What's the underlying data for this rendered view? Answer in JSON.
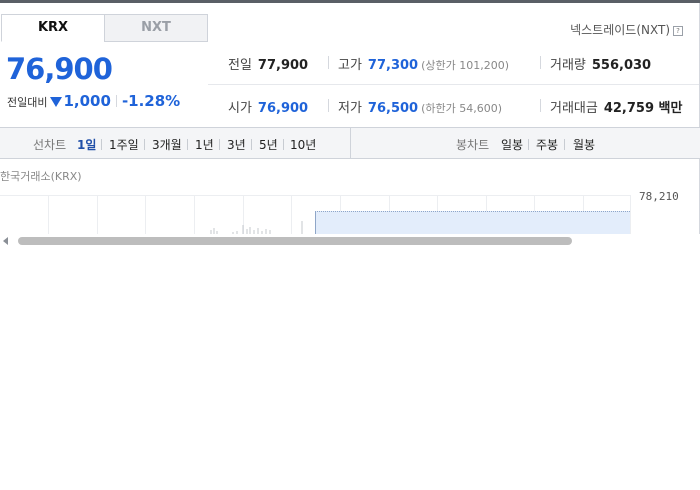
{
  "tabs": [
    {
      "label": "KRX",
      "active": true
    },
    {
      "label": "NXT",
      "active": false
    }
  ],
  "nxt_link": {
    "label": "넥스트레이드(NXT)",
    "icon": "help-icon",
    "icon_glyph": "?"
  },
  "price": {
    "current": "76,900",
    "change_label": "전일대비",
    "change_direction": "down",
    "change_value": "1,000",
    "change_percent": "-1.28%"
  },
  "stats": {
    "prev_close": {
      "label": "전일",
      "value": "77,900"
    },
    "high": {
      "label": "고가",
      "value": "77,300",
      "sub": "(상한가 101,200)"
    },
    "volume": {
      "label": "거래량",
      "value": "556,030"
    },
    "open": {
      "label": "시가",
      "value": "76,900"
    },
    "low": {
      "label": "저가",
      "value": "76,500",
      "sub": "(하한가 54,600)"
    },
    "amount": {
      "label": "거래대금",
      "value": "42,759 백만"
    }
  },
  "period_bar": {
    "line_title": "선차트",
    "line_items": [
      {
        "label": "1일",
        "active": true
      },
      {
        "label": "1주일",
        "active": false
      },
      {
        "label": "3개월",
        "active": false
      },
      {
        "label": "1년",
        "active": false
      },
      {
        "label": "3년",
        "active": false
      },
      {
        "label": "5년",
        "active": false
      },
      {
        "label": "10년",
        "active": false
      }
    ],
    "candle_title": "봉차트",
    "candle_items": [
      {
        "label": "일봉",
        "active": false
      },
      {
        "label": "주봉",
        "active": false
      },
      {
        "label": "월봉",
        "active": false
      }
    ]
  },
  "chart": {
    "exchange_label": "한국거래소(KRX)",
    "y_label": "78,210",
    "fill_color": "#e3edfb",
    "line_color": "#8fa6c8"
  },
  "colors": {
    "accent_blue": "#1f63d9",
    "active_period": "#1f4ea8"
  }
}
